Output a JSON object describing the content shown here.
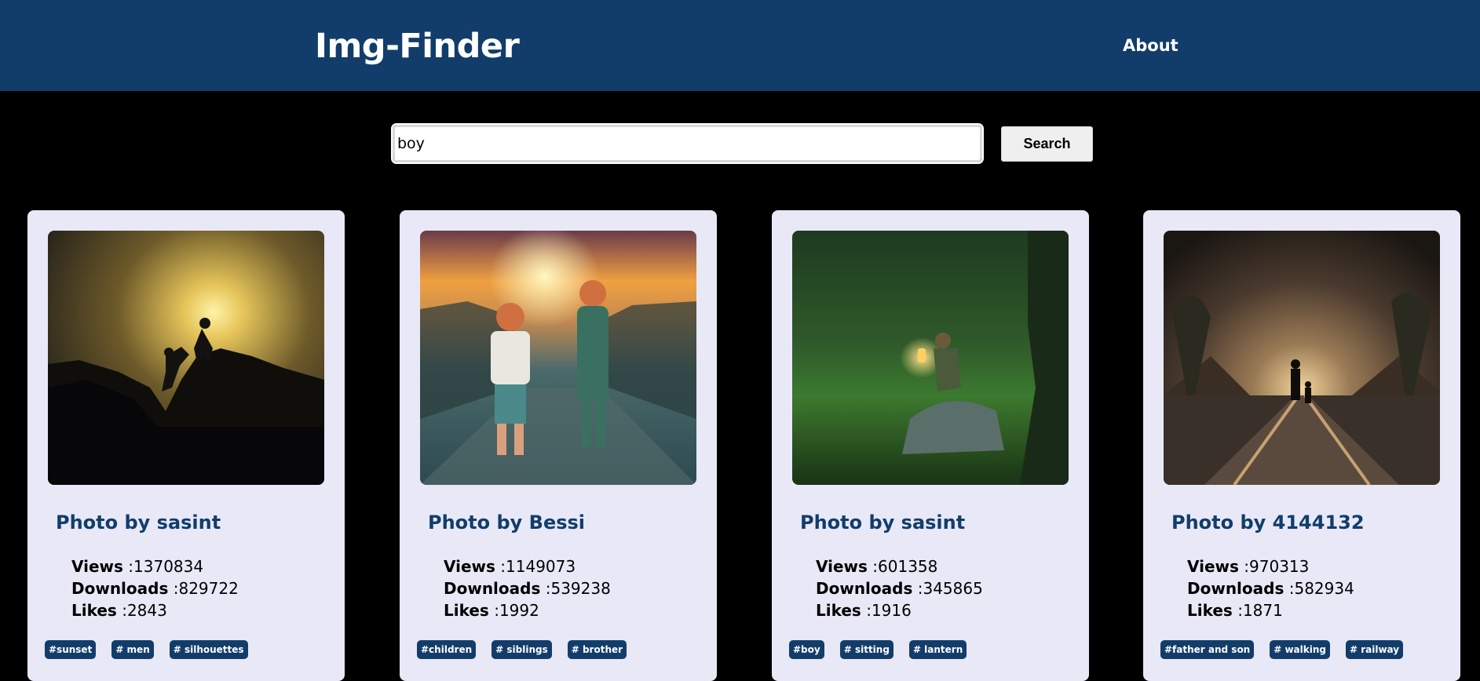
{
  "header": {
    "brand": "Img-Finder",
    "nav_about": "About"
  },
  "search": {
    "value": "boy",
    "button_label": "Search"
  },
  "cards": [
    {
      "title": "Photo by sasint",
      "views_label": "Views",
      "views": ":1370834",
      "downloads_label": "Downloads",
      "downloads": ":829722",
      "likes_label": "Likes",
      "likes": ":2843",
      "tags": [
        "#sunset",
        "# men",
        "# silhouettes"
      ]
    },
    {
      "title": "Photo by Bessi",
      "views_label": "Views",
      "views": ":1149073",
      "downloads_label": "Downloads",
      "downloads": ":539238",
      "likes_label": "Likes",
      "likes": ":1992",
      "tags": [
        "#children",
        "# siblings",
        "# brother"
      ]
    },
    {
      "title": "Photo by sasint",
      "views_label": "Views",
      "views": ":601358",
      "downloads_label": "Downloads",
      "downloads": ":345865",
      "likes_label": "Likes",
      "likes": ":1916",
      "tags": [
        "#boy",
        "# sitting",
        "# lantern"
      ]
    },
    {
      "title": "Photo by 4144132",
      "views_label": "Views",
      "views": ":970313",
      "downloads_label": "Downloads",
      "downloads": ":582934",
      "likes_label": "Likes",
      "likes": ":1871",
      "tags": [
        "#father and son",
        "# walking",
        "# railway"
      ]
    }
  ],
  "colors": {
    "navbar": "#123d6a",
    "page_background": "#000000",
    "card_background": "#e8e8f6",
    "tag_background": "#123d6a",
    "title_color": "#123d6a"
  }
}
